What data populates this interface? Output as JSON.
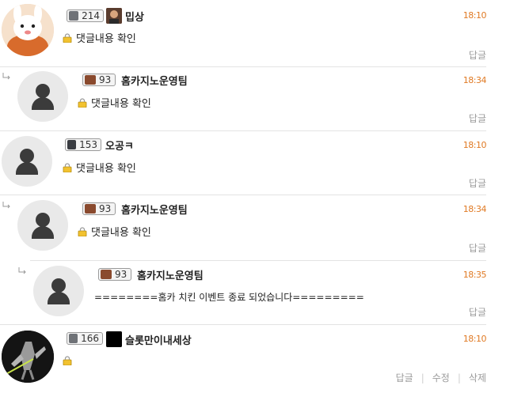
{
  "comments": [
    {
      "nick": "밉상",
      "level": "214",
      "time": "18:10",
      "content": "댓글내용 확인",
      "reply": "답글"
    },
    {
      "nick": "홈카지노운영팀",
      "level": "93",
      "time": "18:34",
      "content": "댓글내용 확인",
      "reply": "답글"
    },
    {
      "nick": "오공ㅋ",
      "level": "153",
      "time": "18:10",
      "content": "댓글내용 확인",
      "reply": "답글"
    },
    {
      "nick": "홈카지노운영팀",
      "level": "93",
      "time": "18:34",
      "content": "댓글내용 확인",
      "reply": "답글"
    },
    {
      "nick": "홈카지노운영팀",
      "level": "93",
      "time": "18:35",
      "content": "========홈카 치킨 이벤트 종료 되었습니다=========",
      "reply": "답글"
    },
    {
      "nick": "슬롯만이내세상",
      "level": "166",
      "time": "18:10",
      "content": "",
      "actions": {
        "reply": "답글",
        "edit": "수정",
        "delete": "삭제"
      }
    }
  ],
  "colors": {
    "time": "#e07a24",
    "border": "#e3e3e3",
    "muted": "#9a9a9a"
  },
  "icons": [
    "lock-icon",
    "default-avatar-icon",
    "reply-indent-icon",
    "level-badge-icon"
  ]
}
